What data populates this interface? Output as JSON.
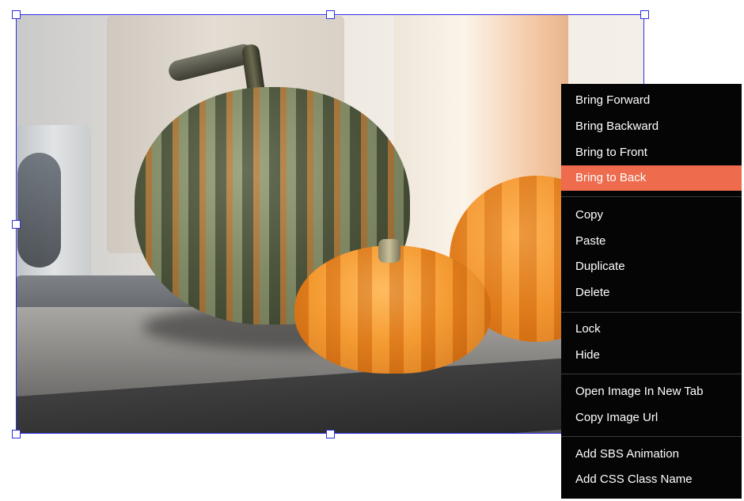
{
  "canvas": {
    "image_description_icon": "photo-image",
    "selection_color": "#2f2fe8"
  },
  "context_menu": {
    "highlight_color": "#ee6b4d",
    "groups": [
      {
        "items": [
          "Bring Forward",
          "Bring Backward",
          "Bring to Front",
          "Bring to Back"
        ]
      },
      {
        "items": [
          "Copy",
          "Paste",
          "Duplicate",
          "Delete"
        ]
      },
      {
        "items": [
          "Lock",
          "Hide"
        ]
      },
      {
        "items": [
          "Open Image In New Tab",
          "Copy Image Url"
        ]
      },
      {
        "items": [
          "Add SBS Animation",
          "Add CSS Class Name"
        ]
      }
    ],
    "active_item": "Bring to Back"
  }
}
